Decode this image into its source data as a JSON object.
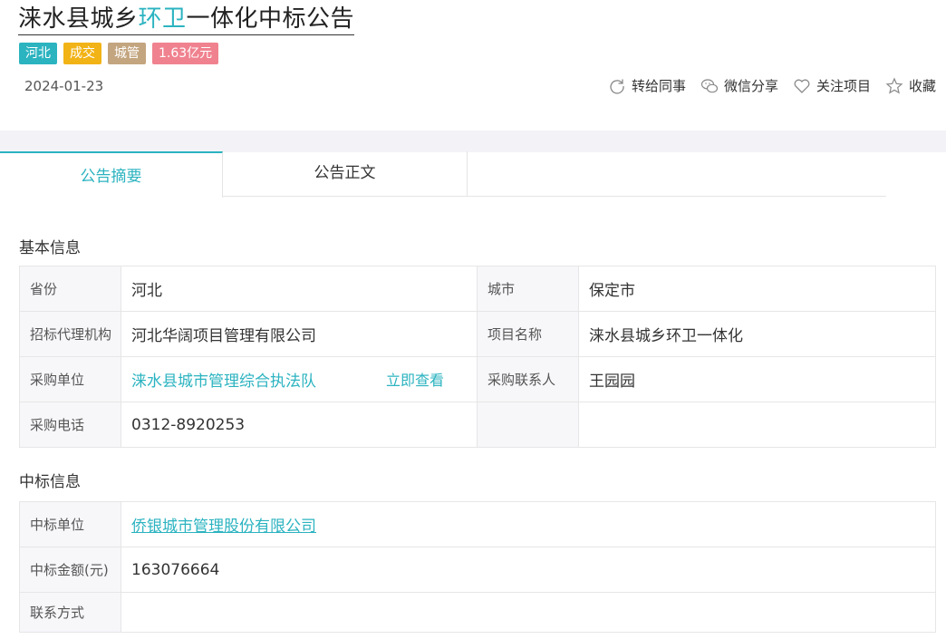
{
  "header": {
    "title_pre": "涞水县城乡",
    "title_hl": "环卫",
    "title_post": "一体化中标公告",
    "tags": [
      "河北",
      "成交",
      "城管",
      "1.63亿元"
    ],
    "date": "2024-01-23"
  },
  "actions": [
    {
      "label": "转给同事",
      "icon": "refresh-icon"
    },
    {
      "label": "微信分享",
      "icon": "wechat-icon"
    },
    {
      "label": "关注项目",
      "icon": "heart-icon"
    },
    {
      "label": "收藏",
      "icon": "star-icon"
    }
  ],
  "tabs": [
    "公告摘要",
    "公告正文"
  ],
  "basic": {
    "title": "基本信息",
    "province_label": "省份",
    "province": "河北",
    "city_label": "城市",
    "city": "保定市",
    "agency_label": "招标代理机构",
    "agency": "河北华阔项目管理有限公司",
    "project_label": "项目名称",
    "project": "涞水县城乡环卫一体化",
    "buyer_label": "采购单位",
    "buyer": "涞水县城市管理综合执法队",
    "view_now": "立即查看",
    "contact_label": "采购联系人",
    "contact": "王园园",
    "phone_label": "采购电话",
    "phone": "0312-8920253"
  },
  "winner": {
    "title": "中标信息",
    "unit_label": "中标单位",
    "unit": "侨银城市管理股份有限公司",
    "amount_label": "中标金额(元)",
    "amount": "163076664",
    "contact_label": "联系方式",
    "contact": ""
  },
  "colors": {
    "accent": "#2bb3c0",
    "tag_status": "#f2b316",
    "tag_industry": "#c3a57f",
    "tag_amount": "#f0828f"
  }
}
